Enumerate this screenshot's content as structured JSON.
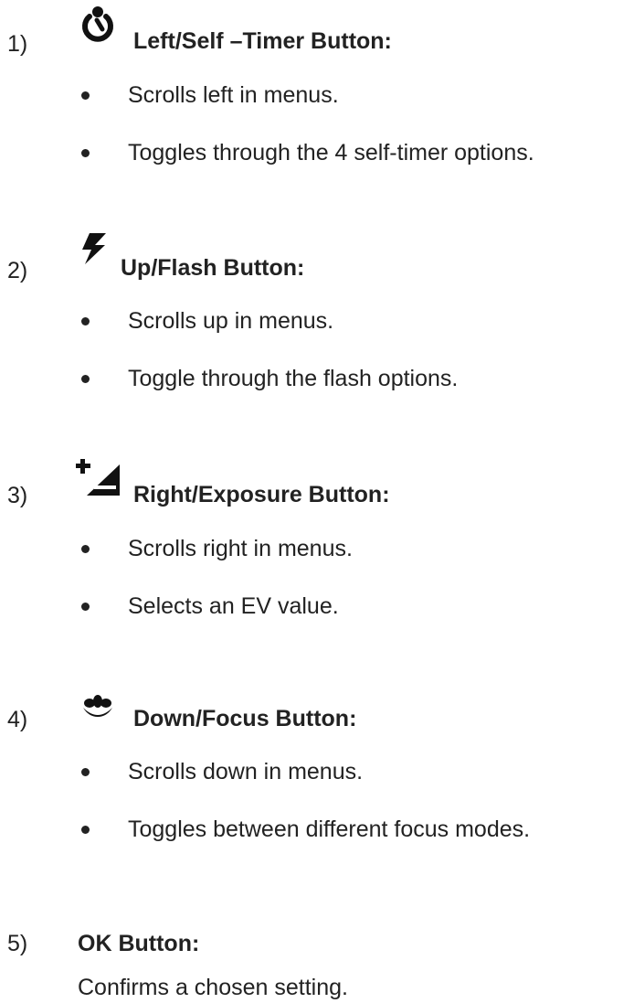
{
  "sections": [
    {
      "number": "1)",
      "icon": "self-timer-icon",
      "title": "Left/Self –Timer Button:",
      "bullets": [
        "Scrolls left in menus.",
        "Toggles through the 4 self-timer options."
      ]
    },
    {
      "number": "2)",
      "icon": "flash-icon",
      "title": "Up/Flash Button:",
      "bullets": [
        "Scrolls up in menus.",
        "Toggle through the flash options."
      ]
    },
    {
      "number": "3)",
      "icon": "exposure-icon",
      "title": "Right/Exposure Button:",
      "bullets": [
        "Scrolls right in menus.",
        "Selects an EV value."
      ]
    },
    {
      "number": "4)",
      "icon": "macro-focus-icon",
      "title": "Down/Focus Button:",
      "bullets": [
        "Scrolls down in menus.",
        "Toggles between different focus modes."
      ]
    },
    {
      "number": "5)",
      "title": "OK Button:",
      "description": "Confirms a chosen setting."
    }
  ]
}
